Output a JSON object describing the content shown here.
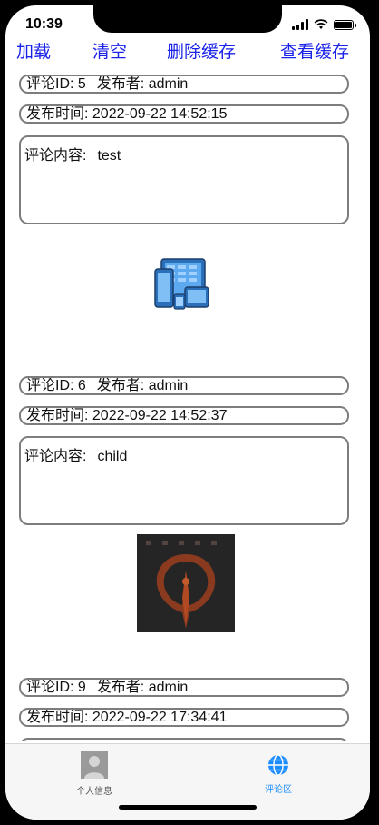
{
  "status": {
    "time": "10:39"
  },
  "toolbar": {
    "load": "加载",
    "clear": "清空",
    "delete_cache": "删除缓存",
    "view_cache": "查看缓存"
  },
  "comments": [
    {
      "id_label": "评论ID: 5",
      "publisher_label": "发布者: admin",
      "time_label": "发布时间: 2022-09-22 14:52:15",
      "content_label": "评论内容:",
      "content": "test",
      "image_icon": "devices-icon"
    },
    {
      "id_label": "评论ID: 6",
      "publisher_label": "发布者: admin",
      "time_label": "发布时间: 2022-09-22 14:52:37",
      "content_label": "评论内容:",
      "content": "child",
      "image_icon": "quake-logo"
    },
    {
      "id_label": "评论ID: 9",
      "publisher_label": "发布者: admin",
      "time_label": "发布时间: 2022-09-22 17:34:41"
    }
  ],
  "tabbar": {
    "tabs": [
      {
        "label": "个人信息",
        "icon": "person-icon",
        "active": false
      },
      {
        "label": "评论区",
        "icon": "globe-icon",
        "active": true
      }
    ],
    "active_color": "#1a8cff"
  }
}
